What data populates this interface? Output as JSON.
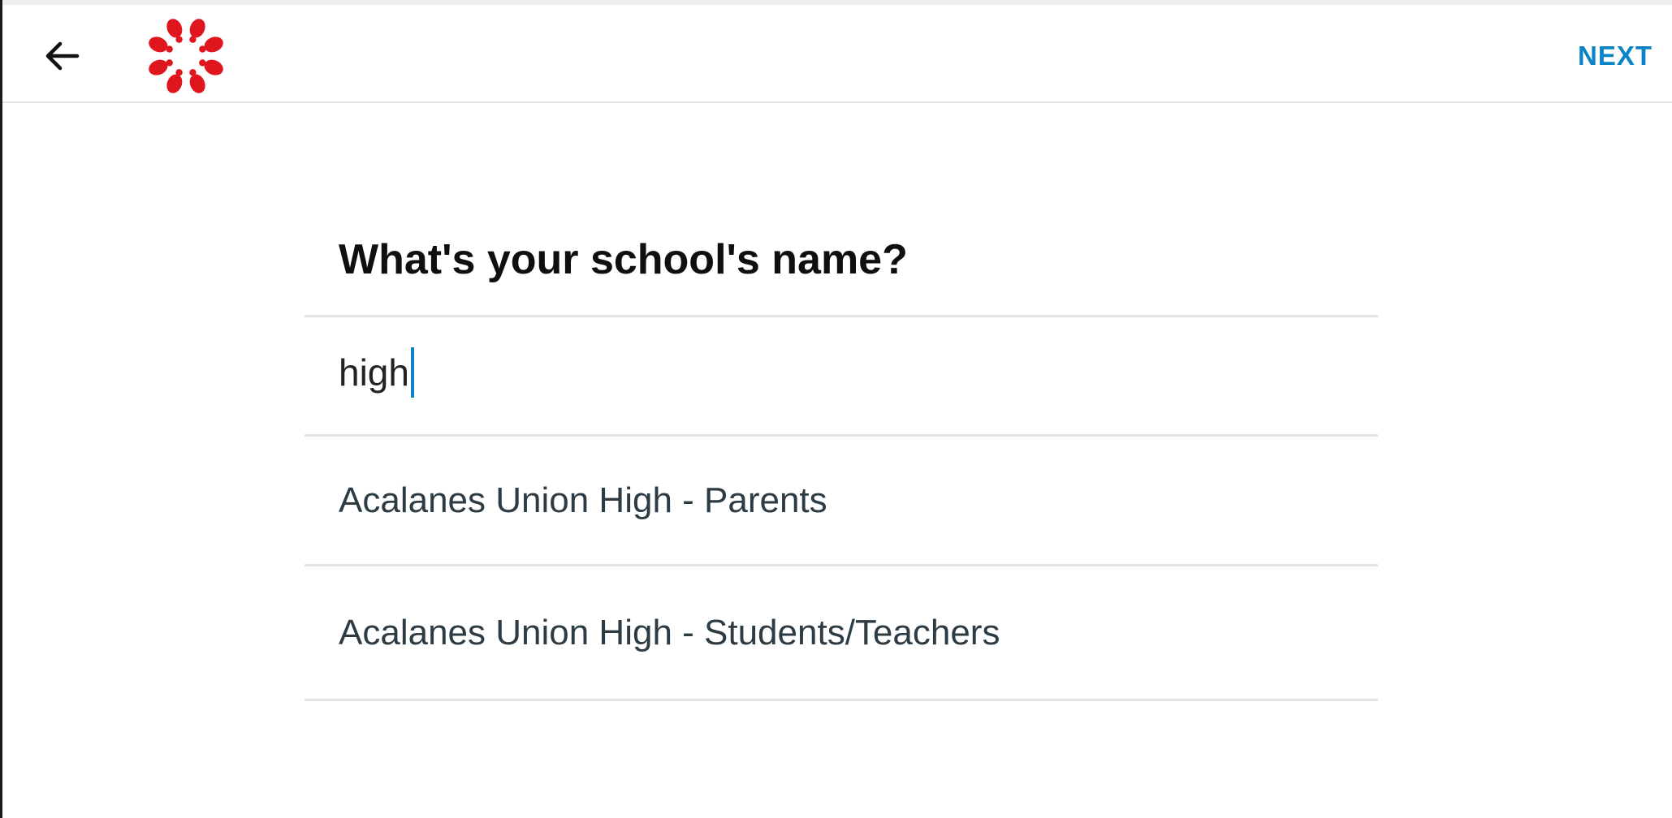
{
  "toolbar": {
    "back_icon": "arrow-left-icon",
    "logo_icon": "canvas-logo-icon",
    "next_label": "NEXT"
  },
  "main": {
    "title": "What's your school's name?",
    "search": {
      "value": "high"
    },
    "results": [
      {
        "label": "Acalanes Union High - Parents"
      },
      {
        "label": "Acalanes Union High - Students/Teachers"
      }
    ]
  },
  "colors": {
    "accent": "#0b84c6",
    "brand_red": "#e0161e",
    "result_text": "#2d3b45",
    "divider": "#e2e2e2"
  }
}
